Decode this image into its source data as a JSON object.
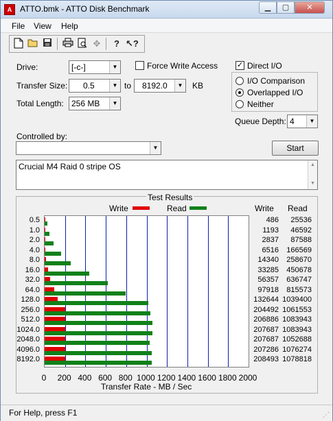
{
  "window": {
    "title": "ATTO.bmk - ATTO Disk Benchmark"
  },
  "menu": [
    "File",
    "View",
    "Help"
  ],
  "toolbar": {
    "buttons": [
      "new-icon",
      "open-icon",
      "save-icon",
      "print-icon",
      "print-preview-icon",
      "move-icon",
      "help-icon",
      "context-help-icon"
    ]
  },
  "settings": {
    "drive_label": "Drive:",
    "drive_value": "[-c-]",
    "transfer_size_label": "Transfer Size:",
    "transfer_from": "0.5",
    "to_label": "to",
    "transfer_to": "8192.0",
    "kb_label": "KB",
    "total_length_label": "Total Length:",
    "total_length": "256 MB",
    "force_write_label": "Force Write Access",
    "force_write_checked": false,
    "direct_io_label": "Direct I/O",
    "direct_io_checked": true,
    "io_options": [
      "I/O Comparison",
      "Overlapped I/O",
      "Neither"
    ],
    "io_selected": 1,
    "queue_depth_label": "Queue Depth:",
    "queue_depth": "4",
    "controlled_by_label": "Controlled by:",
    "controlled_by_value": "",
    "start_label": "Start",
    "description": "Crucial M4 Raid 0 stripe OS"
  },
  "results": {
    "title": "Test Results",
    "write_label": "Write",
    "read_label": "Read",
    "write_color": "#e00000",
    "read_color": "#11811a",
    "col_write": "Write",
    "col_read": "Read",
    "x_axis_title": "Transfer Rate - MB / Sec"
  },
  "chart_data": {
    "type": "bar",
    "orientation": "horizontal",
    "categories": [
      "0.5",
      "1.0",
      "2.0",
      "4.0",
      "8.0",
      "16.0",
      "32.0",
      "64.0",
      "128.0",
      "256.0",
      "512.0",
      "1024.0",
      "2048.0",
      "4096.0",
      "8192.0"
    ],
    "series": [
      {
        "name": "Write",
        "values": [
          486,
          1193,
          2837,
          6516,
          14340,
          33285,
          56357,
          97918,
          132644,
          204492,
          206886,
          207687,
          207687,
          207286,
          208493
        ]
      },
      {
        "name": "Read",
        "values": [
          25536,
          46592,
          87588,
          166569,
          258670,
          450678,
          636747,
          815573,
          1039400,
          1061553,
          1083943,
          1083943,
          1052688,
          1076274,
          1078818
        ]
      }
    ],
    "xlim": [
      0,
      2000
    ],
    "xticks": [
      0,
      200,
      400,
      600,
      800,
      1000,
      1200,
      1400,
      1600,
      1800,
      2000
    ],
    "xlabel": "Transfer Rate - MB / Sec",
    "grid": true,
    "legend": "top"
  },
  "status": {
    "text": "For Help, press F1"
  }
}
